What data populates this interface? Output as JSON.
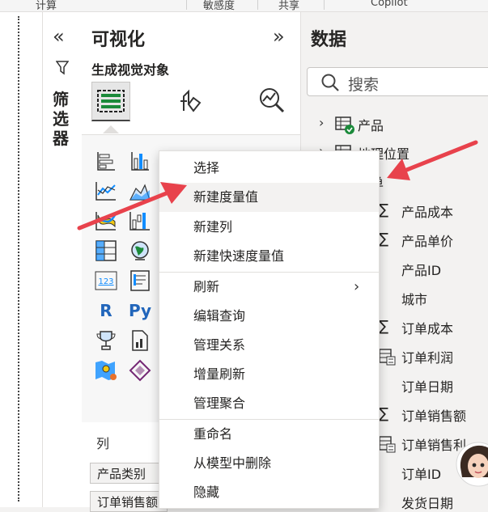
{
  "ribbon": {
    "items": [
      "计算",
      "敏感度",
      "共享",
      "Copilot"
    ]
  },
  "filters_pane": {
    "title": "筛选器",
    "collapse_icon": "double-chevron-left-icon",
    "filter_icon": "funnel-icon"
  },
  "viz_pane": {
    "title": "可视化",
    "subtitle": "生成视觉对象",
    "tabs": [
      "build-visual-icon",
      "format-visual-icon",
      "analytics-icon"
    ],
    "gallery_text_icons": {
      "r": "R",
      "py": "Py",
      "card": "123"
    },
    "columns_label": "列",
    "fields": [
      "产品类别",
      "订单销售额"
    ]
  },
  "data_pane": {
    "title": "数据",
    "search_placeholder": "搜索",
    "tables": [
      {
        "label": "产品"
      },
      {
        "label": "地理位置"
      },
      {
        "label": "单"
      }
    ],
    "fields": [
      {
        "label": "产品成本",
        "kind": "sum"
      },
      {
        "label": "产品单价",
        "kind": "sum"
      },
      {
        "label": "产品ID",
        "kind": "plain"
      },
      {
        "label": "城市",
        "kind": "plain"
      },
      {
        "label": "订单成本",
        "kind": "sum"
      },
      {
        "label": "订单利润",
        "kind": "calc"
      },
      {
        "label": "订单日期",
        "kind": "plain"
      },
      {
        "label": "订单销售额",
        "kind": "sum"
      },
      {
        "label": "订单销售利",
        "kind": "calc"
      },
      {
        "label": "订单ID",
        "kind": "plain"
      },
      {
        "label": "发货日期",
        "kind": "plain"
      }
    ]
  },
  "context_menu": {
    "items": [
      {
        "label": "选择"
      },
      {
        "label": "新建度量值",
        "highlighted": true
      },
      {
        "label": "新建列"
      },
      {
        "label": "新建快速度量值"
      },
      {
        "label": "刷新",
        "submenu": true
      },
      {
        "label": "编辑查询"
      },
      {
        "label": "管理关系"
      },
      {
        "label": "增量刷新"
      },
      {
        "label": "管理聚合"
      },
      {
        "label": "重命名"
      },
      {
        "label": "从模型中删除"
      },
      {
        "label": "隐藏"
      }
    ]
  },
  "colors": {
    "annotation_arrow": "#e8424c",
    "accent": "#118dff",
    "pane_bg": "#f3f2f1"
  }
}
